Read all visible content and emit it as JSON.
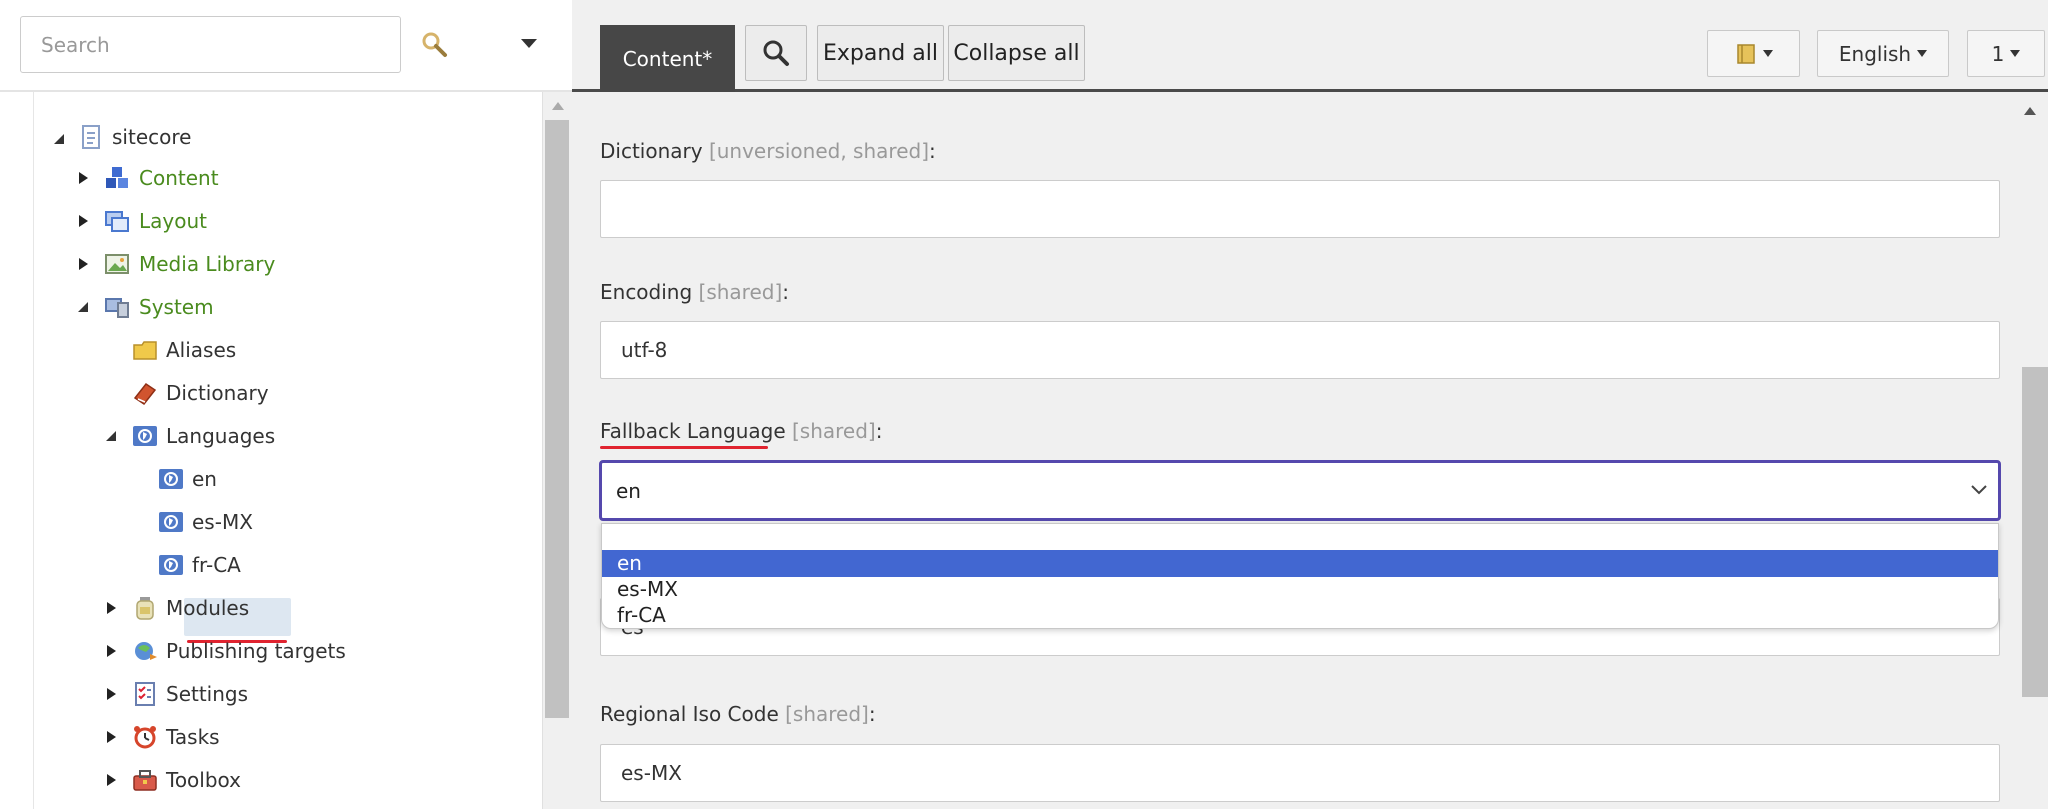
{
  "search": {
    "placeholder": "Search",
    "value": ""
  },
  "tree": {
    "root": "sitecore",
    "content": "Content",
    "layout": "Layout",
    "media_library": "Media Library",
    "system": "System",
    "aliases": "Aliases",
    "dictionary": "Dictionary",
    "languages": "Languages",
    "lang_en": "en",
    "lang_es_mx": "es-MX",
    "lang_fr_ca": "fr-CA",
    "modules": "Modules",
    "publishing_targets": "Publishing targets",
    "settings": "Settings",
    "tasks": "Tasks",
    "toolbox": "Toolbox"
  },
  "toolbar": {
    "tab_content": "Content*",
    "expand_all": "Expand all",
    "collapse_all": "Collapse all",
    "language": "English",
    "version": "1"
  },
  "fields": {
    "dictionary": {
      "label": "Dictionary",
      "meta": "[unversioned, shared]",
      "suffix": ":",
      "value": ""
    },
    "encoding": {
      "label": "Encoding",
      "meta": "[shared]",
      "suffix": ":",
      "value": "utf-8"
    },
    "fallback": {
      "label": "Fallback Language",
      "meta": "[shared]",
      "suffix": ":",
      "value": "en",
      "options": [
        "",
        "en",
        "es-MX",
        "fr-CA"
      ],
      "selected": "en"
    },
    "iso_hidden": {
      "value": "es"
    },
    "regional": {
      "label": "Regional Iso Code",
      "meta": "[shared]",
      "suffix": ":",
      "value": "es-MX"
    }
  },
  "colors": {
    "accent_select_border": "#5548ad",
    "option_highlight": "#4267d1",
    "tree_link_green": "#4a8b1e",
    "annotation_red": "#e0232f",
    "tab_active_bg": "#474747"
  },
  "icons": {
    "search": "magnifier-icon",
    "tree_root": "document-icon",
    "content": "cubes-icon",
    "layout": "windows-icon",
    "media": "picture-icon",
    "system": "computer-icon",
    "aliases": "folder-icon",
    "dictionary": "book-icon",
    "languages": "globe-icon",
    "modules": "jar-icon",
    "publishing": "globe-arrows-icon",
    "settings": "checklist-icon",
    "tasks": "alarm-clock-icon",
    "toolbox": "toolbox-icon"
  }
}
